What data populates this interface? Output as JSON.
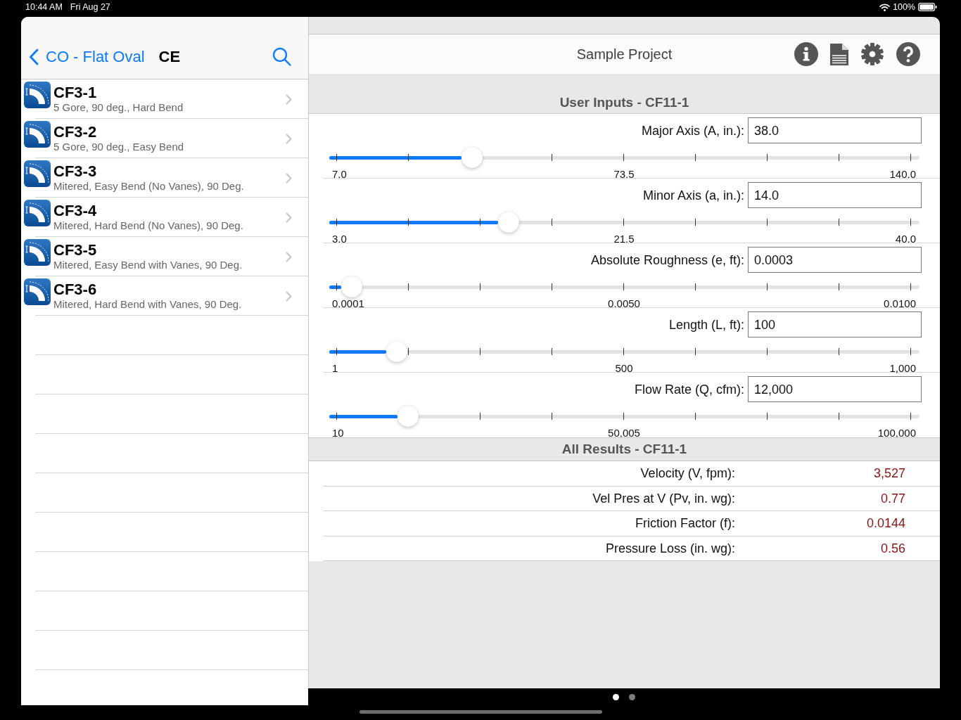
{
  "status_bar": {
    "time": "10:44 AM",
    "date": "Fri Aug 27",
    "battery": "100%"
  },
  "sidebar": {
    "back_label": "CO - Flat Oval",
    "title": "CE",
    "items": [
      {
        "title": "CF3-1",
        "subtitle": "5 Gore, 90 deg., Hard Bend"
      },
      {
        "title": "CF3-2",
        "subtitle": "5 Gore, 90 deg., Easy Bend"
      },
      {
        "title": "CF3-3",
        "subtitle": "Mitered, Easy Bend (No Vanes), 90 Deg."
      },
      {
        "title": "CF3-4",
        "subtitle": "Mitered, Hard Bend (No Vanes), 90 Deg."
      },
      {
        "title": "CF3-5",
        "subtitle": "Mitered, Easy Bend with Vanes, 90 Deg."
      },
      {
        "title": "CF3-6",
        "subtitle": "Mitered, Hard Bend with Vanes, 90 Deg."
      }
    ]
  },
  "header": {
    "title": "Sample Project"
  },
  "inputs": {
    "heading": "User Inputs - CF11-1",
    "fields": [
      {
        "label": "Major Axis (A, in.):",
        "value": "38.0",
        "level": 0.236,
        "min_label": "7.0",
        "mid_label": "73.5",
        "max_label": "140.0"
      },
      {
        "label": "Minor Axis (a, in.):",
        "value": "14.0",
        "level": 0.3,
        "min_label": "3.0",
        "mid_label": "21.5",
        "max_label": "40.0"
      },
      {
        "label": "Absolute Roughness (e, ft):",
        "value": "0.0003",
        "level": 0.027,
        "min_label": "0.0001",
        "mid_label": "0.0050",
        "max_label": "0.0100"
      },
      {
        "label": "Length (L, ft):",
        "value": "100",
        "level": 0.105,
        "min_label": "1",
        "mid_label": "500",
        "max_label": "1,000"
      },
      {
        "label": "Flow Rate (Q, cfm):",
        "value": "12,000",
        "level": 0.125,
        "min_label": "10",
        "mid_label": "50,005",
        "max_label": "100,000"
      }
    ]
  },
  "results": {
    "heading": "All Results - CF11-1",
    "rows": [
      {
        "label": "Velocity (V, fpm):",
        "value": "3,527"
      },
      {
        "label": "Vel Pres at V (Pv, in. wg):",
        "value": "0.77"
      },
      {
        "label": "Friction Factor (f):",
        "value": "0.0144"
      },
      {
        "label": "Pressure Loss (in. wg):",
        "value": "0.56"
      }
    ]
  },
  "page_indicator": [
    {
      "selected": true
    },
    {
      "selected": false
    }
  ]
}
